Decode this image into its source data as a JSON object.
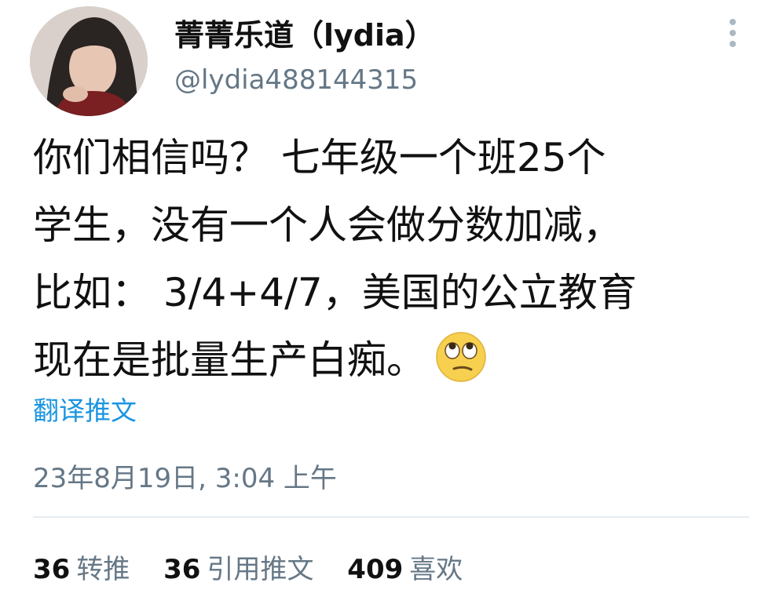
{
  "author": {
    "display_name": "菁菁乐道（lydia）",
    "handle": "@lydia488144315"
  },
  "tweet": {
    "text_lines": [
      "你们相信吗？ 七年级一个班25个",
      "学生，没有一个人会做分数加减，",
      "比如： 3/4+4/7，美国的公立教育",
      "现在是批量生产白痴。"
    ],
    "emoji": "eye-roll-emoji-icon",
    "translate_label": "翻译推文",
    "timestamp": "23年8月19日, 3:04 上午"
  },
  "stats": {
    "retweets_count": "36",
    "retweets_label": "转推",
    "quotes_count": "36",
    "quotes_label": "引用推文",
    "likes_count": "409",
    "likes_label": "喜欢"
  },
  "colors": {
    "link": "#1b95e0",
    "secondary_text": "#657786",
    "divider": "#e6ecf0"
  }
}
